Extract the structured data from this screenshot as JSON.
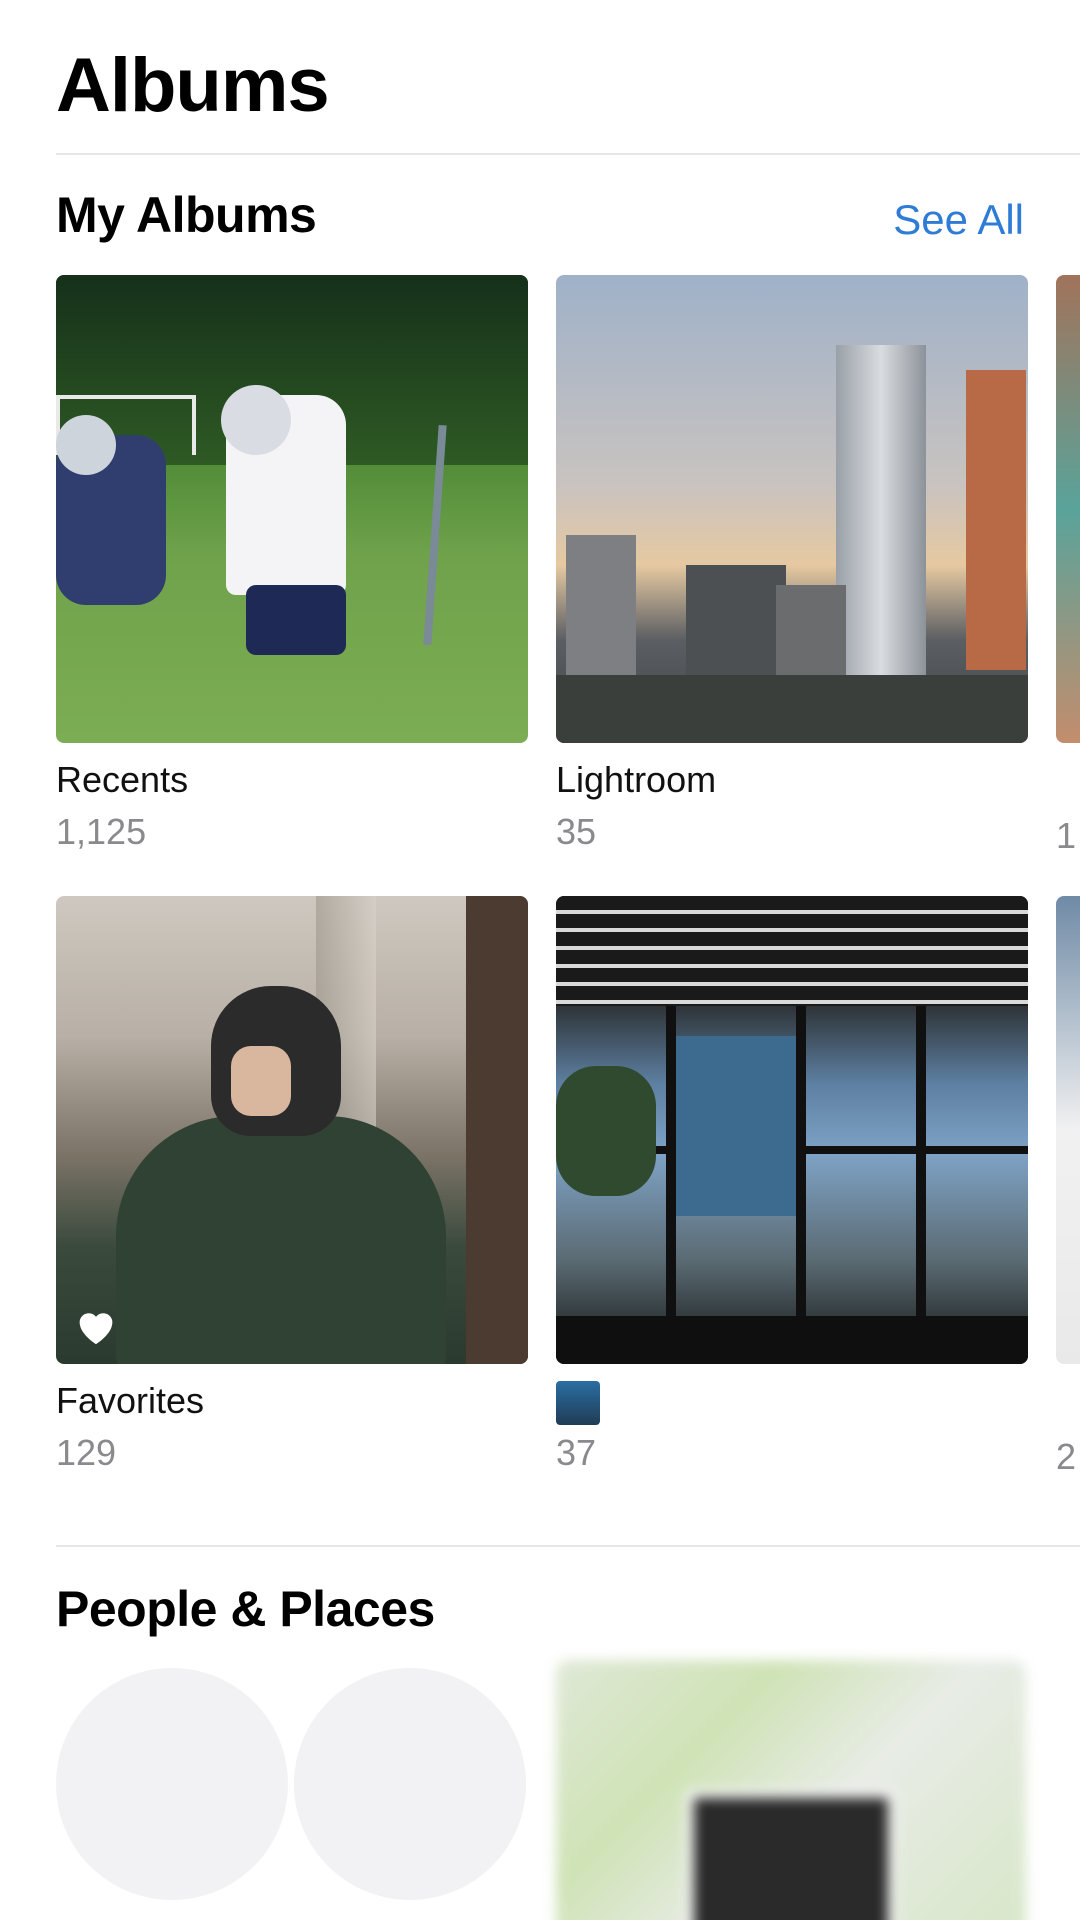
{
  "header": {
    "title": "Albums"
  },
  "my_albums": {
    "title": "My Albums",
    "see_all": "See All",
    "albums": [
      {
        "name": "Recents",
        "count": "1,125"
      },
      {
        "name": "Lightroom",
        "count": "35"
      },
      {
        "name": "Favorites",
        "count": "129"
      },
      {
        "name": "",
        "count": "37"
      }
    ],
    "peek_counts": [
      "1",
      "2"
    ]
  },
  "people_places": {
    "title": "People & Places"
  },
  "icons": {
    "favorite": "heart-icon",
    "thumbnail": "album-thumbnail-icon"
  },
  "colors": {
    "accent": "#2f7cd6",
    "secondary_text": "#8a8a8e",
    "divider": "#e6e6e9"
  }
}
